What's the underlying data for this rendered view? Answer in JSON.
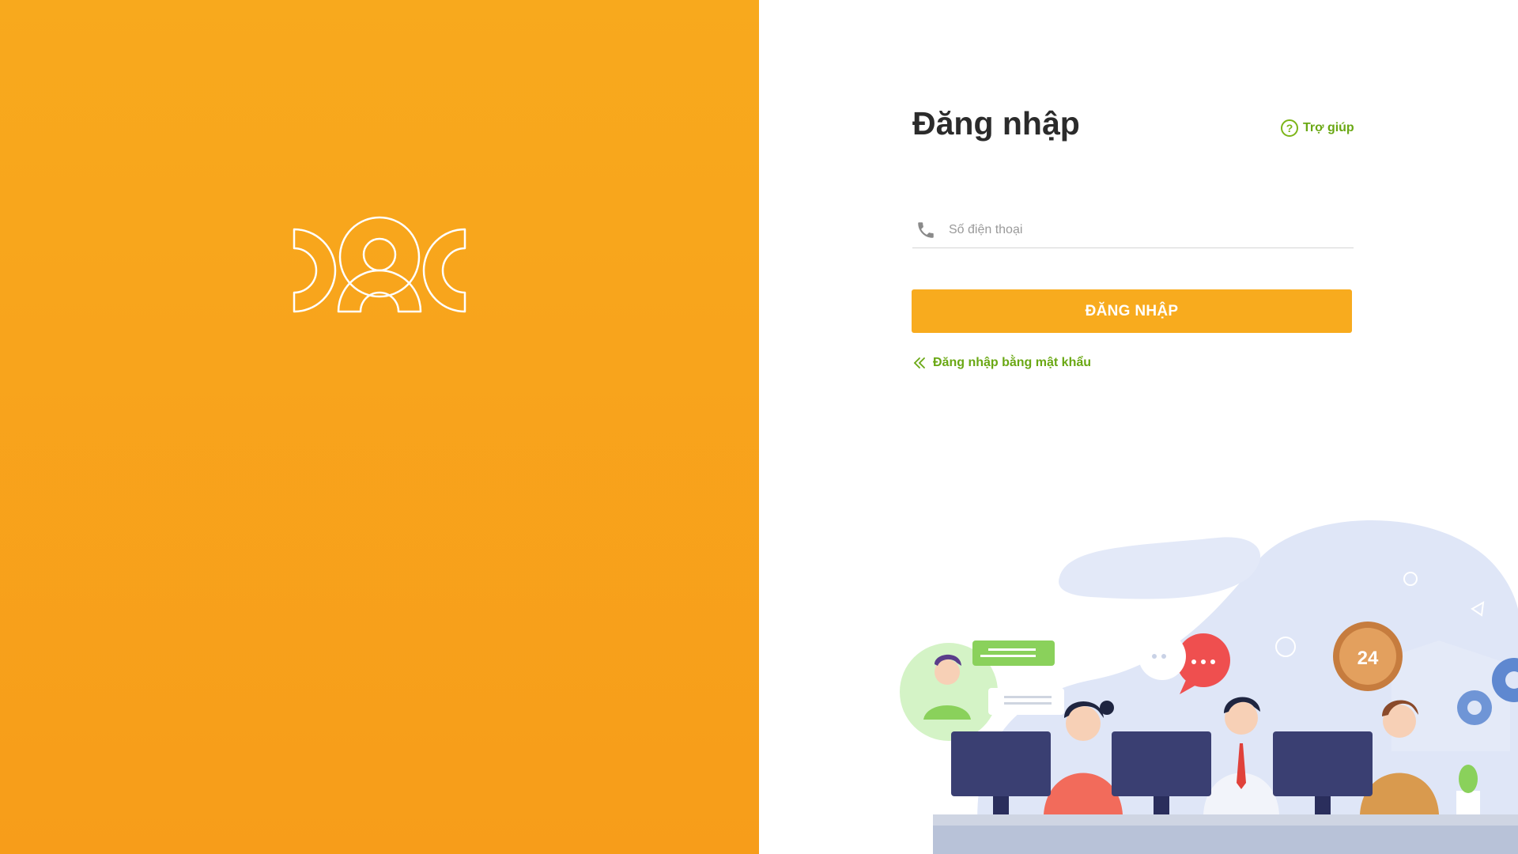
{
  "login": {
    "title": "Đăng nhập",
    "help_label": "Trợ giúp",
    "phone_placeholder": "Số điện thoại",
    "phone_value": "",
    "submit_label": "ĐĂNG NHẬP",
    "password_login_label": "Đăng nhập bằng mật khẩu"
  },
  "speech_bubble_text": "24",
  "icons": {
    "brand": "brand-logo-icon",
    "help": "question-circle-icon",
    "phone": "phone-icon",
    "password_link": "double-chevron-left-icon"
  },
  "colors": {
    "brand_orange": "#f8a91d",
    "button_orange": "#f8ab1e",
    "link_green": "#6aa814",
    "title_text": "#2b2b2b",
    "placeholder_gray": "#9a9a9a"
  }
}
